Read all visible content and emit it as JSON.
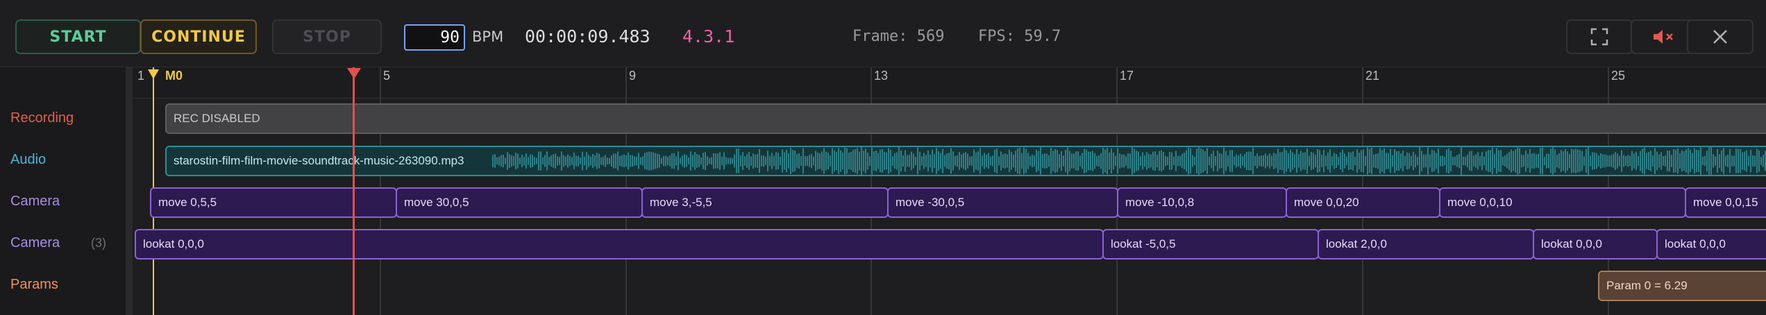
{
  "toolbar": {
    "start_label": "START",
    "continue_label": "CONTINUE",
    "stop_label": "STOP",
    "bpm_value": "90",
    "bpm_label": "BPM",
    "time": "00:00:09.483",
    "position": "4.3.1",
    "frame": "Frame: 569",
    "fps": "FPS: 59.7",
    "icons": [
      "fullscreen-icon",
      "mute-icon",
      "close-icon"
    ]
  },
  "lanes": [
    {
      "label": "Recording",
      "color": "#e0604f"
    },
    {
      "label": "Audio",
      "color": "#4fb6d6"
    },
    {
      "label": "Camera",
      "color": "#a88ce6"
    },
    {
      "label": "Camera",
      "color": "#a88ce6",
      "count": "(3)"
    },
    {
      "label": "Params",
      "color": "#f0905c"
    }
  ],
  "ruler": {
    "ticks": [
      "1",
      "5",
      "9",
      "13",
      "17",
      "21",
      "25"
    ],
    "marker": "M0"
  },
  "clips": {
    "recording": "REC DISABLED",
    "audio": "starostin-film-film-movie-soundtrack-music-263090.mp3",
    "camera": [
      "move  0,5,5",
      "move  30,0,5",
      "move  3,-5,5",
      "move  -30,0,5",
      "move  -10,0,8",
      "move  0,0,20",
      "move  0,0,10",
      "move  0,0,15"
    ],
    "lookat": [
      "lookat 0,0,0",
      "lookat -5,0,5",
      "lookat 2,0,0",
      "lookat 0,0,0",
      "lookat 0,0,0"
    ],
    "params": [
      "Param 0 = 6.29"
    ]
  },
  "colors": {
    "accent_start": "#5ccc98",
    "accent_continue": "#f2c84b",
    "playhead": "#e05050",
    "position": "#ea62a4"
  }
}
